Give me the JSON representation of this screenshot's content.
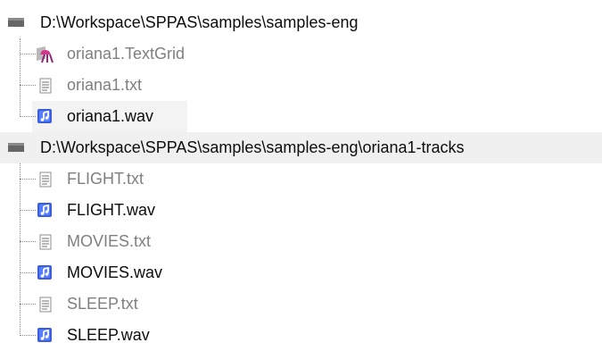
{
  "tree": {
    "folders": [
      {
        "path": "D:\\Workspace\\SPPAS\\samples\\samples-eng",
        "files": [
          {
            "name": "oriana1.TextGrid",
            "type": "textgrid-icon",
            "dim": true
          },
          {
            "name": "oriana1.txt",
            "type": "text-file-icon",
            "dim": true
          },
          {
            "name": "oriana1.wav",
            "type": "audio-file-icon",
            "dim": false
          }
        ]
      },
      {
        "path": "D:\\Workspace\\SPPAS\\samples\\samples-eng\\oriana1-tracks",
        "files": [
          {
            "name": "FLIGHT.txt",
            "type": "text-file-icon",
            "dim": true
          },
          {
            "name": "FLIGHT.wav",
            "type": "audio-file-icon",
            "dim": false
          },
          {
            "name": "MOVIES.txt",
            "type": "text-file-icon",
            "dim": true
          },
          {
            "name": "MOVIES.wav",
            "type": "audio-file-icon",
            "dim": false
          },
          {
            "name": "SLEEP.txt",
            "type": "text-file-icon",
            "dim": true
          },
          {
            "name": "SLEEP.wav",
            "type": "audio-file-icon",
            "dim": false
          }
        ]
      }
    ]
  },
  "colors": {
    "selected_background": "#f0f0f0",
    "dim_text": "#7f7f7f",
    "text": "#0d0d0d",
    "audio_icon": "#3d5edb"
  }
}
